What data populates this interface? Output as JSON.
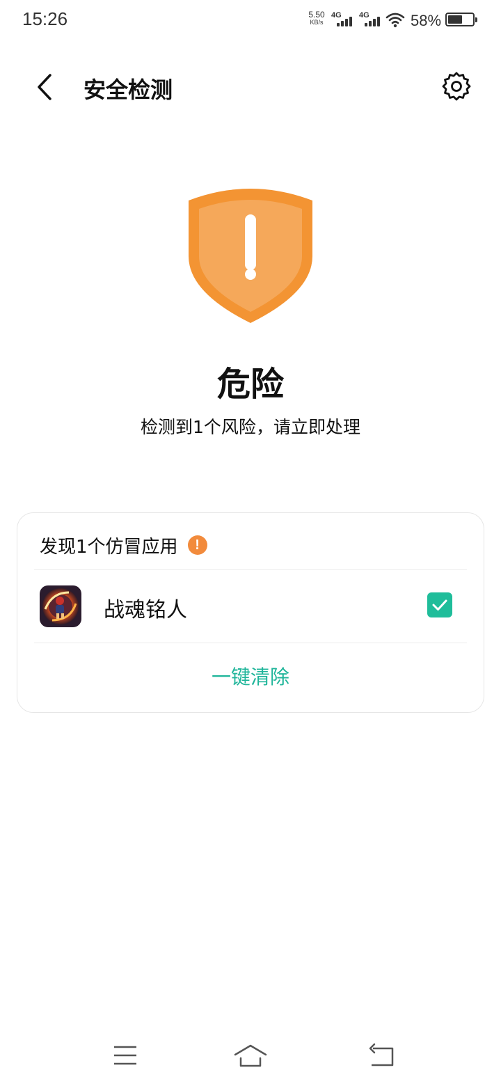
{
  "status_bar": {
    "time": "15:26",
    "net_speed_value": "5.50",
    "net_speed_unit": "KB/s",
    "sim1_label": "4G",
    "sim2_label": "4G",
    "battery_percent_text": "58%",
    "battery_level": 0.58
  },
  "header": {
    "title": "安全检测"
  },
  "result": {
    "status_title": "危险",
    "status_desc": "检测到1个风险，请立即处理",
    "icon": "warning-shield-icon",
    "accent_color": "#F39433"
  },
  "risk_card": {
    "title": "发现1个仿冒应用",
    "apps": [
      {
        "name": "战魂铭人",
        "checked": true,
        "icon": "app-icon"
      }
    ],
    "action_label": "一键清除",
    "action_color": "#1FB59A"
  },
  "nav_bar": {
    "icons": [
      "menu-icon",
      "home-icon",
      "back-icon"
    ]
  }
}
